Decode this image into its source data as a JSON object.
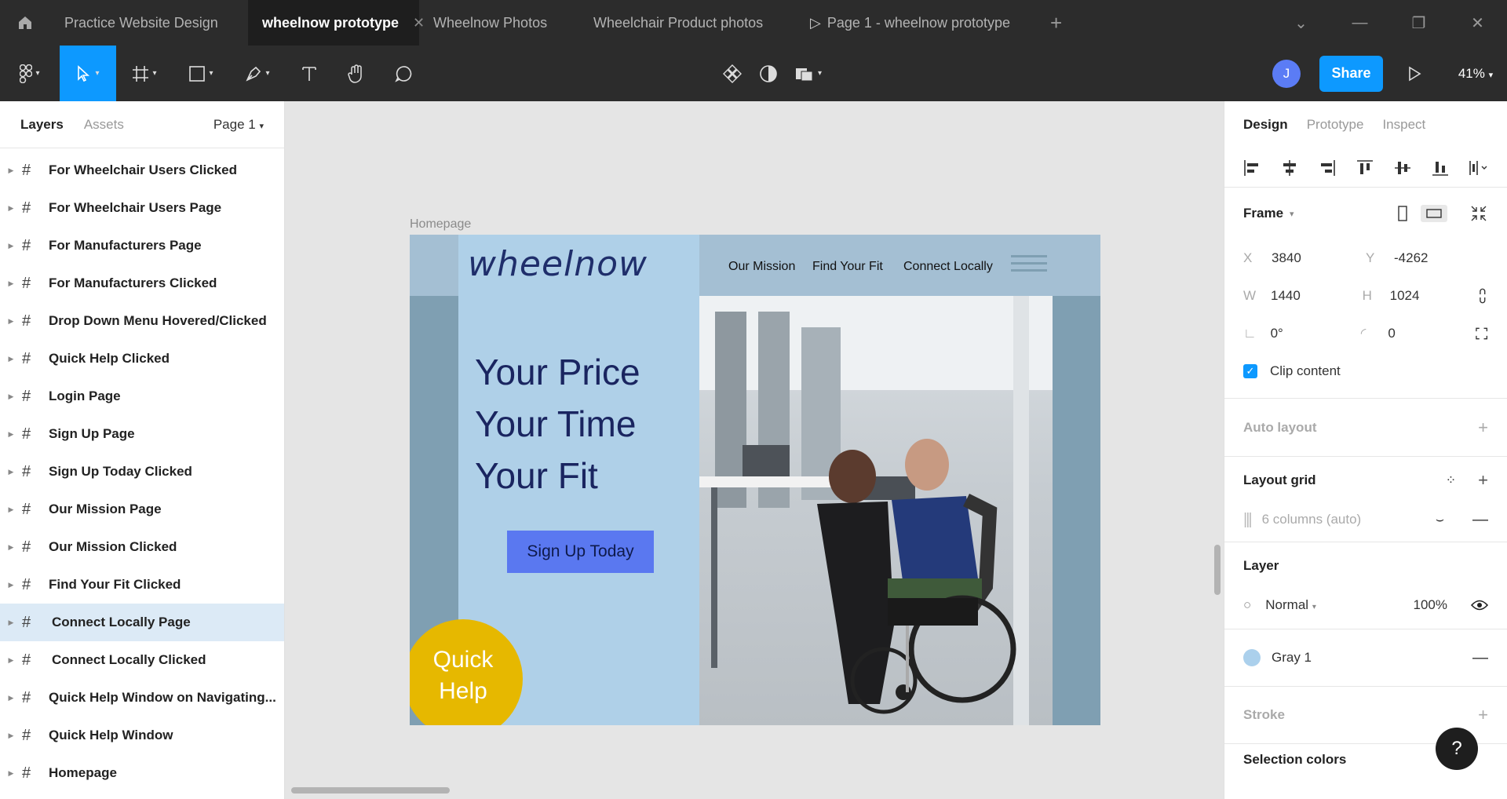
{
  "tabs": [
    {
      "label": "Practice Website Design"
    },
    {
      "label": "wheelnow prototype",
      "active": true
    },
    {
      "label": "Wheelnow Photos"
    },
    {
      "label": "Wheelchair Product photos"
    },
    {
      "label": "Page 1 - wheelnow prototype"
    }
  ],
  "toolbar": {
    "share_label": "Share",
    "avatar_initial": "J",
    "zoom": "41%"
  },
  "left_panel": {
    "tab_layers": "Layers",
    "tab_assets": "Assets",
    "page_select": "Page 1",
    "layers": [
      "For Wheelchair Users Clicked",
      "For Wheelchair Users Page",
      "For Manufacturers Page",
      "For Manufacturers Clicked",
      "Drop Down Menu Hovered/Clicked",
      "Quick Help Clicked",
      "Login Page",
      "Sign Up Page",
      "Sign Up Today Clicked",
      "Our Mission Page",
      "Our Mission Clicked",
      "Find Your Fit Clicked",
      "Connect Locally Page",
      "Connect Locally Clicked",
      "Quick Help Window on Navigating...",
      "Quick Help Window",
      "Homepage"
    ],
    "selected_layer": "Connect Locally Page"
  },
  "canvas": {
    "frame_label": "Homepage",
    "logo": "wheelnow",
    "nav": [
      "Our Mission",
      "Find Your Fit",
      "Connect Locally"
    ],
    "headline": [
      "Your Price",
      "Your Time",
      "Your Fit"
    ],
    "cta": "Sign Up Today",
    "quick_help": [
      "Quick",
      "Help"
    ],
    "colors": {
      "frame_bg": "#7f9fb2",
      "panel": "#afd0e8",
      "cta": "#5a78f0",
      "quick_help": "#e6b800"
    }
  },
  "right_panel": {
    "tab_design": "Design",
    "tab_prototype": "Prototype",
    "tab_inspect": "Inspect",
    "frame_title": "Frame",
    "x_label": "X",
    "x": "3840",
    "y_label": "Y",
    "y": "-4262",
    "w_label": "W",
    "w": "1440",
    "h_label": "H",
    "h": "1024",
    "rotation": "0°",
    "radius": "0",
    "clip_content": "Clip content",
    "auto_layout": "Auto layout",
    "layout_grid": "Layout grid",
    "grid_desc": "6 columns (auto)",
    "layer_title": "Layer",
    "blend": "Normal",
    "opacity": "100%",
    "fill_name": "Gray 1",
    "stroke": "Stroke",
    "selection_colors": "Selection colors",
    "help": "?"
  }
}
